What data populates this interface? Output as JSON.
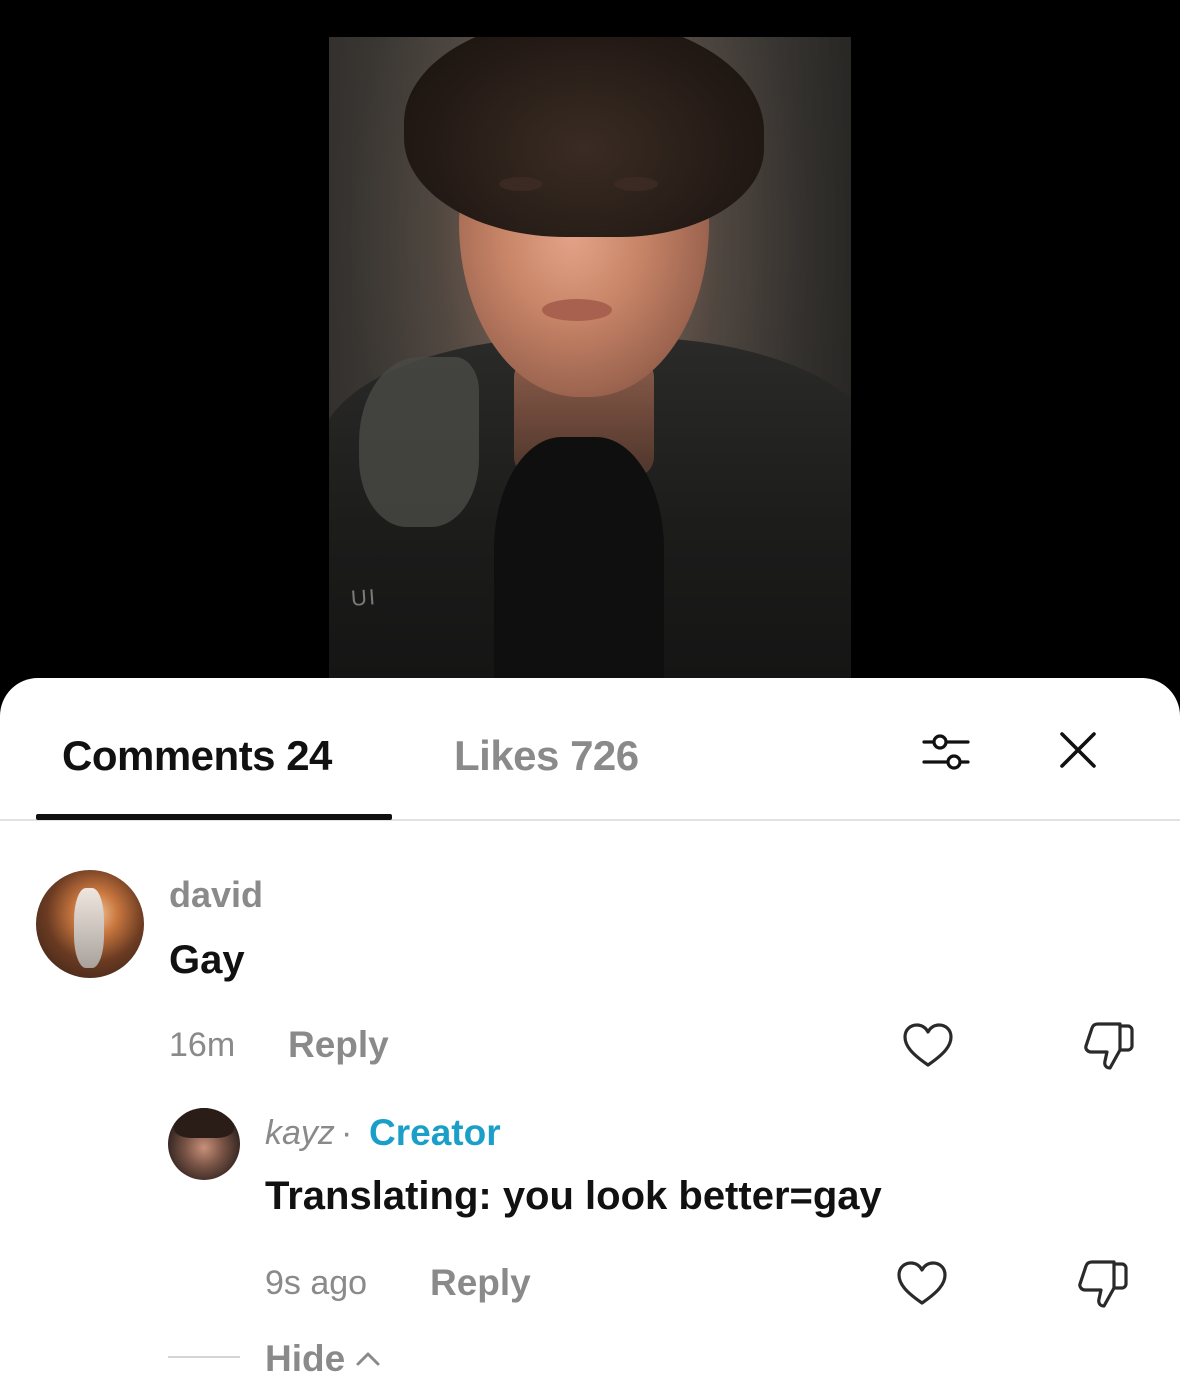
{
  "video": {
    "watermark_text": "UI"
  },
  "tabs": {
    "comments_label": "Comments 24",
    "likes_label": "Likes 726"
  },
  "comments": [
    {
      "username": "david",
      "text": "Gay",
      "time": "16m",
      "reply_label": "Reply"
    }
  ],
  "replies": [
    {
      "username": "kayz",
      "separator": "·",
      "badge": "Creator",
      "text": "Translating: you look better=gay",
      "time": "9s ago",
      "reply_label": "Reply"
    }
  ],
  "hide_label": "Hide",
  "colors": {
    "creator_badge": "#1aa0c8",
    "muted_text": "#8a8a8a",
    "primary_text": "#111111"
  },
  "icons": {
    "filter": "sliders-icon",
    "close": "close-icon",
    "like": "heart-outline-icon",
    "dislike": "thumbs-down-icon",
    "collapse": "chevron-up-icon"
  }
}
